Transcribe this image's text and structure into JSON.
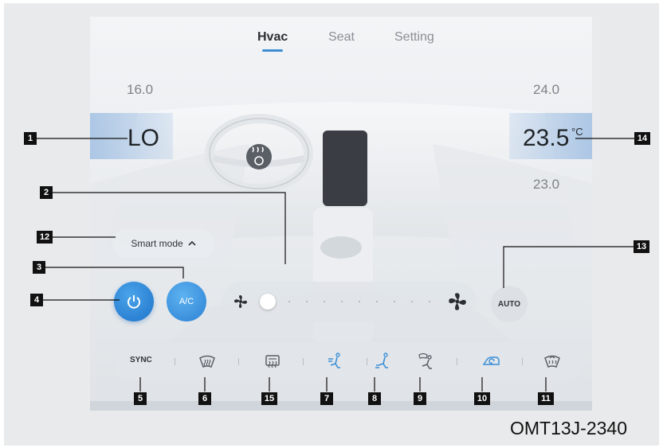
{
  "tabs": [
    {
      "label": "Hvac",
      "active": true
    },
    {
      "label": "Seat",
      "active": false
    },
    {
      "label": "Setting",
      "active": false
    }
  ],
  "left_zone": {
    "upper": "16.0",
    "current": "LO"
  },
  "right_zone": {
    "upper": "24.0",
    "current": "23.5",
    "unit": "°C",
    "lower": "23.0"
  },
  "smart_mode": {
    "label": "Smart mode",
    "icon": "chevron-up-icon"
  },
  "controls": {
    "power": {
      "icon": "power-icon",
      "on": true
    },
    "ac": {
      "label": "A/C"
    },
    "fan": {
      "level": 0,
      "levels": 10,
      "left_icon": "fan-low-icon",
      "right_icon": "fan-high-icon"
    },
    "auto": {
      "label": "AUTO"
    }
  },
  "bottom_bar": {
    "sync_label": "SYNC",
    "icons": [
      "front-defrost-icon",
      "rear-defrost-icon",
      "airflow-face-icon",
      "airflow-feet-icon",
      "airflow-windshield-feet-icon",
      "recirculation-icon",
      "max-defrost-icon"
    ]
  },
  "callouts": [
    "1",
    "2",
    "3",
    "4",
    "5",
    "6",
    "7",
    "8",
    "9",
    "10",
    "11",
    "12",
    "13",
    "14",
    "15"
  ],
  "figure_code": "OMT13J-2340",
  "colors": {
    "accent": "#2e82d4",
    "callout": "#111111"
  }
}
